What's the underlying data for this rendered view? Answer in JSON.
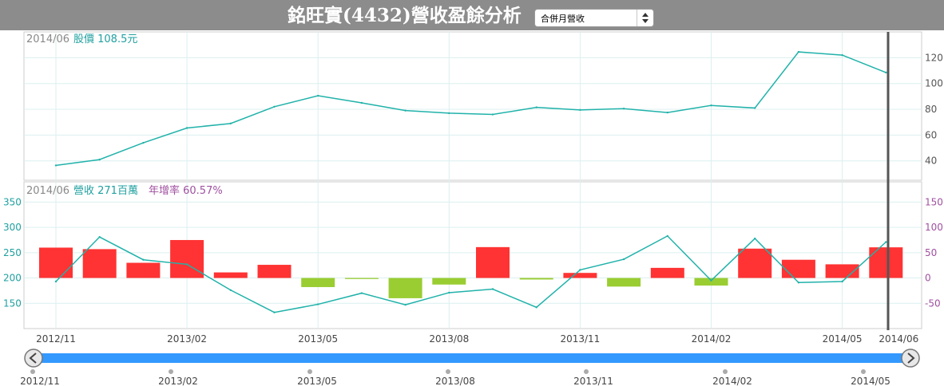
{
  "title": "銘旺實(4432)營收盈餘分析",
  "selector": {
    "selected": "合併月營收"
  },
  "price_legend": {
    "date": "2014/06",
    "label": "股價 108.5元"
  },
  "revenue_legend": {
    "date": "2014/06",
    "label": "營收 271百萬",
    "yoy": "年增率 60.57%"
  },
  "colors": {
    "line": "#20b2aa",
    "positive_bar": "#ff3333",
    "negative_bar": "#9acd32",
    "cursor": "#555555",
    "slider": "#3399ff"
  },
  "chart_data": [
    {
      "type": "line",
      "title": "股價",
      "x": [
        "2012/11",
        "2012/12",
        "2013/01",
        "2013/02",
        "2013/03",
        "2013/04",
        "2013/05",
        "2013/06",
        "2013/07",
        "2013/08",
        "2013/09",
        "2013/10",
        "2013/11",
        "2013/12",
        "2014/01",
        "2014/02",
        "2014/03",
        "2014/04",
        "2014/05",
        "2014/06"
      ],
      "series": [
        {
          "name": "股價",
          "values": [
            36.5,
            41,
            54,
            65.5,
            69,
            82,
            90.5,
            85,
            79,
            77,
            76,
            81.5,
            79.5,
            80.5,
            77.5,
            83,
            81,
            124.5,
            122,
            108.5
          ]
        }
      ],
      "ylim": [
        25,
        140
      ],
      "yticks": [
        40,
        60,
        80,
        100,
        120
      ],
      "grid": true
    },
    {
      "type": "bar",
      "title": "營收 / 年增率",
      "x": [
        "2012/11",
        "2012/12",
        "2013/01",
        "2013/02",
        "2013/03",
        "2013/04",
        "2013/05",
        "2013/06",
        "2013/07",
        "2013/08",
        "2013/09",
        "2013/10",
        "2013/11",
        "2013/12",
        "2014/01",
        "2014/02",
        "2014/03",
        "2014/04",
        "2014/05",
        "2014/06"
      ],
      "series": [
        {
          "name": "年增率",
          "values": [
            60,
            57,
            30,
            75,
            11,
            26,
            -18,
            -2,
            -40,
            -13,
            61,
            -3,
            10,
            -17,
            20,
            -15,
            58,
            36,
            27,
            60.57
          ]
        },
        {
          "name": "營收",
          "values": [
            193,
            281,
            236,
            227,
            176,
            132,
            148,
            170,
            147,
            171,
            178,
            142,
            216,
            237,
            283,
            195,
            278,
            191,
            193,
            271
          ]
        }
      ],
      "yleft": [
        100,
        390
      ],
      "yleft_ticks": [
        150,
        200,
        250,
        300,
        350
      ],
      "yright": [
        -100,
        190
      ],
      "yright_ticks": [
        -50,
        0,
        50,
        100,
        150
      ],
      "grid": true
    }
  ],
  "x_axis_labels": [
    "2012/11",
    "2013/02",
    "2013/05",
    "2013/08",
    "2013/11",
    "2014/02",
    "2014/05",
    "2014/06"
  ],
  "slider_labels": [
    "2012/11",
    "2013/02",
    "2013/05",
    "2013/08",
    "2013/11",
    "2014/02",
    "2014/05"
  ]
}
